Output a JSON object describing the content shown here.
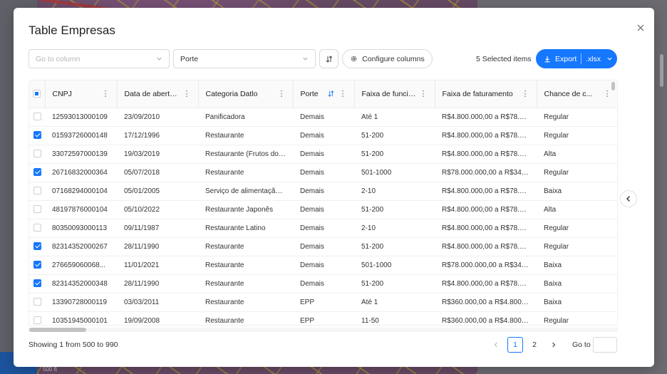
{
  "modal": {
    "title": "Table Empresas"
  },
  "toolbar": {
    "column_placeholder": "Go to column",
    "porte_value": "Porte",
    "configure_label": "Configure columns",
    "selected_label": "5 Selected items",
    "export_label": "Export",
    "export_format": ".xlsx"
  },
  "map": {
    "scale_label": "500 ft"
  },
  "table": {
    "columns": [
      {
        "label": "CNPJ"
      },
      {
        "label": "Data de abertura"
      },
      {
        "label": "Categoria Datlo"
      },
      {
        "label": "Porte"
      },
      {
        "label": "Faixa de funcio..."
      },
      {
        "label": "Faixa de faturamento"
      },
      {
        "label": "Chance de c..."
      }
    ],
    "rows": [
      {
        "checked": false,
        "cnpj": "12593013000109",
        "data": "23/09/2010",
        "categoria": "Panificadora",
        "porte": "Demais",
        "funcionarios": "Até 1",
        "faturamento": "R$4.800.000,00 a R$78.00...",
        "chance": "Regular"
      },
      {
        "checked": true,
        "cnpj": "01593726000148",
        "data": "17/12/1996",
        "categoria": "Restaurante",
        "porte": "Demais",
        "funcionarios": "51-200",
        "faturamento": "R$4.800.000,00 a R$78.00...",
        "chance": "Regular"
      },
      {
        "checked": false,
        "cnpj": "33072597000139",
        "data": "19/03/2019",
        "categoria": "Restaurante (Frutos do ...",
        "porte": "Demais",
        "funcionarios": "51-200",
        "faturamento": "R$4.800.000,00 a R$78.00...",
        "chance": "Alta"
      },
      {
        "checked": true,
        "cnpj": "26716832000364",
        "data": "05/07/2018",
        "categoria": "Restaurante",
        "porte": "Demais",
        "funcionarios": "501-1000",
        "faturamento": "R$78.000.000,00 a R$340...",
        "chance": "Regular"
      },
      {
        "checked": false,
        "cnpj": "07168294000104",
        "data": "05/01/2005",
        "categoria": "Serviço de alimentação ...",
        "porte": "Demais",
        "funcionarios": "2-10",
        "faturamento": "R$4.800.000,00 a R$78.00...",
        "chance": "Baixa"
      },
      {
        "checked": false,
        "cnpj": "48197876000104",
        "data": "05/10/2022",
        "categoria": "Restaurante Japonês",
        "porte": "Demais",
        "funcionarios": "51-200",
        "faturamento": "R$4.800.000,00 a R$78.00...",
        "chance": "Alta"
      },
      {
        "checked": false,
        "cnpj": "80350093000113",
        "data": "09/11/1987",
        "categoria": "Restaurante Latino",
        "porte": "Demais",
        "funcionarios": "2-10",
        "faturamento": "R$4.800.000,00 a R$78.00...",
        "chance": "Regular"
      },
      {
        "checked": true,
        "cnpj": "82314352000267",
        "data": "28/11/1990",
        "categoria": "Restaurante",
        "porte": "Demais",
        "funcionarios": "51-200",
        "faturamento": "R$4.800.000,00 a R$78.00...",
        "chance": "Regular"
      },
      {
        "checked": true,
        "cnpj": "276659060068...",
        "data": "11/01/2021",
        "categoria": "Restaurante",
        "porte": "Demais",
        "funcionarios": "501-1000",
        "faturamento": "R$78.000.000,00 a R$340...",
        "chance": "Baixa"
      },
      {
        "checked": true,
        "cnpj": "82314352000348",
        "data": "28/11/1990",
        "categoria": "Restaurante",
        "porte": "Demais",
        "funcionarios": "51-200",
        "faturamento": "R$4.800.000,00 a R$78.00...",
        "chance": "Baixa"
      },
      {
        "checked": false,
        "cnpj": "13390728000119",
        "data": "03/03/2011",
        "categoria": "Restaurante",
        "porte": "EPP",
        "funcionarios": "Até 1",
        "faturamento": "R$360.000,00 a R$4.800.00...",
        "chance": "Baixa"
      },
      {
        "checked": false,
        "cnpj": "10351945000101",
        "data": "19/09/2008",
        "categoria": "Restaurante",
        "porte": "EPP",
        "funcionarios": "11-50",
        "faturamento": "R$360.000,00 a R$4.800.00...",
        "chance": "Regular"
      }
    ]
  },
  "footer": {
    "showing": "Showing 1 from 500 to 990",
    "pages": [
      "1",
      "2"
    ],
    "active_page": "1",
    "goto_label": "Go to"
  },
  "colors": {
    "accent": "#1677ff"
  }
}
